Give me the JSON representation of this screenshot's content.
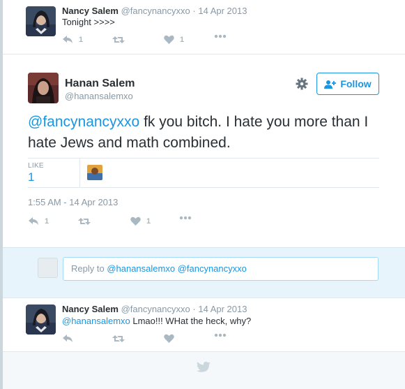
{
  "tweets": {
    "first": {
      "name": "Nancy Salem",
      "handle": "@fancynancyxxo",
      "sep": "·",
      "date": "14 Apr 2013",
      "text": "Tonight >>>>",
      "reply_count": "1",
      "like_count": "1"
    },
    "main": {
      "name": "Hanan Salem",
      "handle": "@hanansalemxo",
      "follow_label": "Follow",
      "mention": "@fancynancyxxo",
      "text_rest": " fk you bitch. I hate you more than I hate Jews and math combined.",
      "stat_label": "LIKE",
      "stat_value": "1",
      "timestamp": "1:55 AM - 14 Apr 2013",
      "reply_count": "1",
      "like_count": "1"
    },
    "reply_box": {
      "prefix": "Reply to ",
      "mentions": "@hanansalemxo @fancynancyxxo"
    },
    "reply": {
      "name": "Nancy Salem",
      "handle": "@fancynancyxxo",
      "sep": "·",
      "date": "14 Apr 2013",
      "mention": "@hanansalemxo",
      "text_rest": " Lmao!!! WHat the heck, why?"
    }
  },
  "icons": {
    "reply": "reply-icon",
    "retweet": "retweet-icon",
    "like": "heart-icon",
    "more": "more-icon",
    "gear": "gear-icon",
    "follow": "add-user-icon",
    "bird": "twitter-bird-icon"
  },
  "colors": {
    "link": "#1b95e0",
    "muted": "#8899a6",
    "icon": "#aab8c2",
    "reply_bg": "#e8f4fb"
  }
}
